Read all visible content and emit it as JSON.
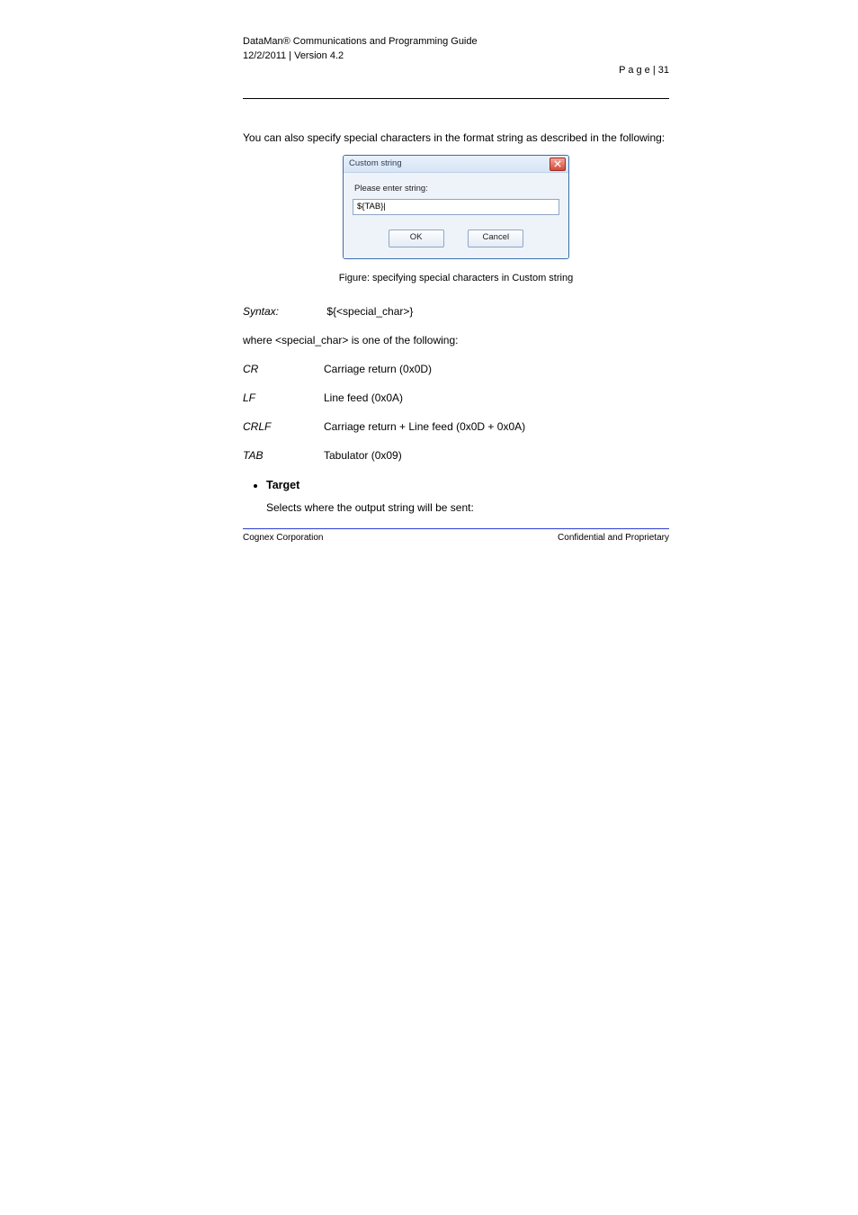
{
  "header": {
    "product": "DataMan® Communications and Programming Guide",
    "date": "12/2/2011 | Version 4.2",
    "pagenum": "P a g e  | 31"
  },
  "intro": "You can also specify special characters in the format string as described in the following:",
  "dialog": {
    "title": "Custom string",
    "prompt": "Please enter string:",
    "value": "${TAB}|",
    "ok": "OK",
    "cancel": "Cancel"
  },
  "caption": "Figure: specifying special characters in Custom string",
  "para_syntax_label": "Syntax:",
  "para_syntax_text": " ${<special_char>}",
  "para_special_intro": "where <special_char> is one of the following:",
  "tokens": {
    "CR": "Carriage return (0x0D)",
    "LF": "Line feed (0x0A)",
    "CRLF": "Carriage return + Line feed (0x0D + 0x0A)",
    "TAB": "Tabulator (0x09)"
  },
  "bullet_title": "Target",
  "bullet_text": "Selects where the output string will be sent:",
  "footer": {
    "company": "Cognex Corporation",
    "confidential": "Confidential and Proprietary"
  }
}
